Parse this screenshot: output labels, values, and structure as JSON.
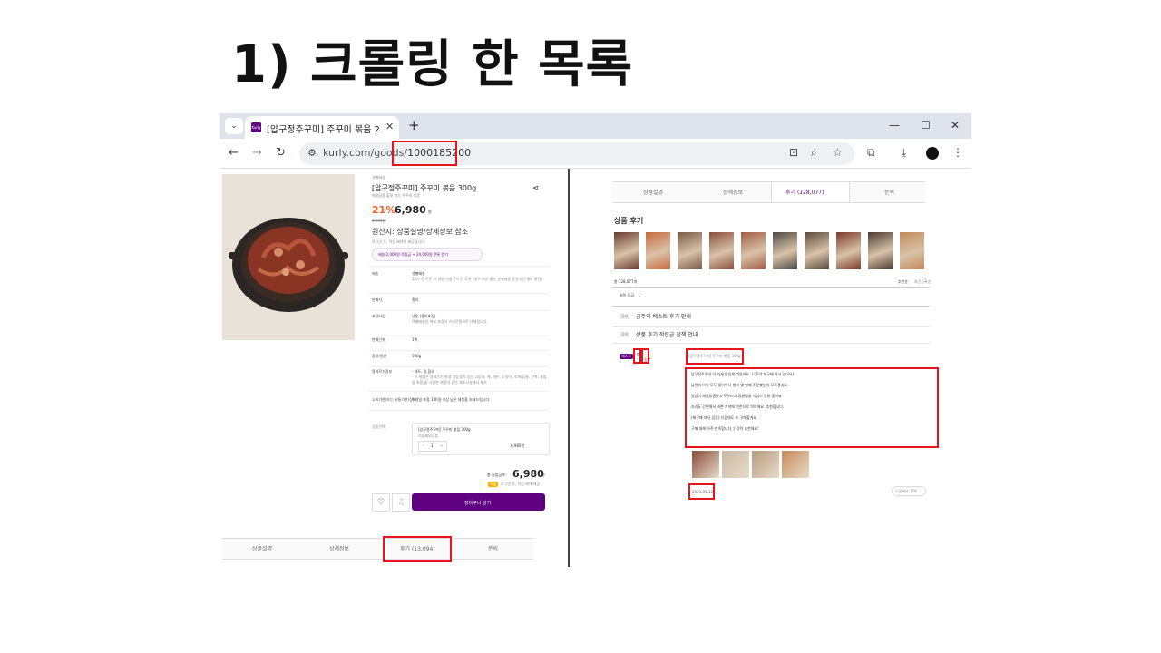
{
  "slide": {
    "title": "1) 크롤링 한 목록"
  },
  "browser": {
    "tab": {
      "favicon": "Kurly",
      "title": "[압구정주꾸미] 주꾸미 볶음 2:"
    },
    "url": {
      "prefix": "kurly.com/goods/",
      "id": "1000185200"
    }
  },
  "product": {
    "delivery": "샛별배송",
    "name": "[압구정주꾸미] 주꾸미 볶음 300g",
    "subtitle": "매콤달콤 불맛 가득 주꾸미 볶음",
    "discount": "21%",
    "price": "6,980",
    "won": "원",
    "orig_price": "8,900원",
    "origin": "원산지: 상품설명/상세정보 참조",
    "login_note": "로그인 후, 적립 혜택이 제공됩니다.",
    "coupon": "배송 2,000원 적립금 + 24,000원 쿠폰 받기",
    "rows": [
      {
        "label": "배송",
        "value": "샛별배송",
        "sub": "23시 전 주문 시 내일 아침 7시 전 도착 (대구·부산·울산 샛별배송 운영시간 별도 확인)"
      },
      {
        "label": "판매자",
        "value": "컬리",
        "sub": ""
      },
      {
        "label": "포장타입",
        "value": "냉동 (종이포장)",
        "sub": "택배배송은 에코 포장이 스티로폼으로 대체됩니다."
      },
      {
        "label": "판매단위",
        "value": "1팩",
        "sub": ""
      },
      {
        "label": "중량/용량",
        "value": "300g",
        "sub": ""
      },
      {
        "label": "알레르기정보",
        "value": "- 대두, 밀 함유",
        "sub": "- 이 제품은 알레르기 발생 가능성이 있는 고등어, 게, 새우, 오징어, 조개류(굴, 전복, 홍합을 포함)을 사용한 제품과 같은 제조시설에서 제조"
      },
      {
        "label": "소비기한(또는 유통기한)정보",
        "value": "수령일 포함 180일 이상 남은 제품을 보내드립니다.",
        "sub": ""
      }
    ],
    "option_label": "상품선택",
    "option_name": "[압구정주꾸미] 주꾸미 볶음 300g",
    "option_qty": "1",
    "option_price": "6,980원",
    "total_label": "총 상품금액 :",
    "total": "6,980",
    "total_won": "원",
    "point_badge": "적립",
    "point_note": "로그인 후, 적립 혜택 제공",
    "cart_btn": "장바구니 담기",
    "tabs": [
      "상품설명",
      "상세정보",
      "후기 (13,094)",
      "문의"
    ]
  },
  "reviews": {
    "tabs": [
      "상품설명",
      "상세정보",
      "후기 (128,077)",
      "문의"
    ],
    "section_title": "상품 후기",
    "count": "총 128,077개",
    "sort": [
      "추천순",
      "최근등록순"
    ],
    "filter": "회원 등급",
    "notices": [
      {
        "badge": "공지",
        "text": "금주의 베스트 후기 안내"
      },
      {
        "badge": "공지",
        "text": "상품 후기 적립금 정책 안내"
      }
    ],
    "badge_best": "베스트",
    "badge_grade": "퍼플",
    "reviewer": "김**",
    "product_line": "[압구정주꾸미] 주꾸미 볶음 300g",
    "body": [
      "압구정주꾸미 이 가게 맛있게 먹었어요 :) (후기 재구매 의사 있어요)",
      "남편과 아이 모두 좋아해서 벌써 몇 번째 주문했는지 모르겠네요.",
      "양념이 매콤달콤하고 주꾸미가 탱글탱글 식감이 정말 좋아요.",
      "조리도 간편해서 바쁜 저녁에 반찬으로 딱이에요. 추천합니다.",
      "(재구매 의사 있음) 다음에도 또 구매할게요.",
      "구매 대해 아주 만족합니다 :) 강력 추천해요!"
    ],
    "date": "2023.05.12",
    "helpful": "도움돼요 158"
  }
}
